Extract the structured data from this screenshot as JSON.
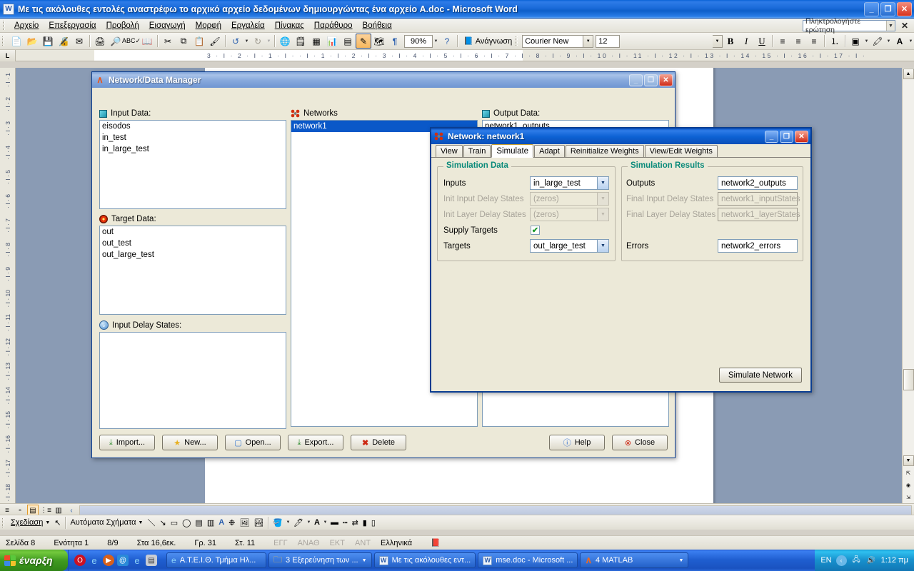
{
  "word": {
    "title": "Με τις ακόλουθες εντολές αναστρέφω το αρχικό αρχείο δεδομένων  δημιουργώντας ένα αρχείο A.doc - Microsoft Word",
    "title_icon": "word-document-icon",
    "minimize": "_",
    "restore": "❐",
    "close": "✕",
    "menus": [
      {
        "label": "Αρχείο"
      },
      {
        "label": "Επεξεργασία"
      },
      {
        "label": "Προβολή"
      },
      {
        "label": "Εισαγωγή"
      },
      {
        "label": "Μορφή"
      },
      {
        "label": "Εργαλεία"
      },
      {
        "label": "Πίνακας"
      },
      {
        "label": "Παράθυρο"
      },
      {
        "label": "Βοήθεια"
      }
    ],
    "ask_a_question": {
      "value": "Πληκτρολογήστε ερώτηση",
      "close": "✕"
    },
    "toolbar": {
      "zoom": "90%",
      "reading_label": "Ανάγνωση",
      "font_name": "Courier New",
      "font_size": "12",
      "bold": "B",
      "italic": "I",
      "underline": "U",
      "icons": [
        "new-document-icon",
        "open-folder-icon",
        "save-icon",
        "permission-icon",
        "email-icon",
        "print-icon",
        "print-preview-icon",
        "spelling-check-icon",
        "research-icon",
        "cut-icon",
        "copy-icon",
        "paste-icon",
        "format-painter-icon",
        "undo-icon",
        "redo-icon",
        "insert-hyperlink-icon",
        "tables-borders-icon",
        "insert-table-icon",
        "insert-excel-icon",
        "columns-icon",
        "drawing-icon",
        "document-map-icon",
        "show-formatting-icon",
        "help-icon"
      ]
    },
    "ruler": {
      "horizontal": "3 · I · 2 · I · 1 · I ·  · I · 1 · I · 2 · I · 3 · I · 4 · I · 5 · I · 6 · I · 7 · I · 8 · I · 9 · I · 10 · I · 11 · I · 12 · I · 13 · I · 14 ·  15 · I · 16 · I · 17 · I ·",
      "vertical": [
        "1",
        "2",
        "3",
        "4",
        "5",
        "6",
        "7",
        "8",
        "9",
        "10",
        "11",
        "12",
        "13",
        "14",
        "15",
        "16",
        "17",
        "18"
      ]
    },
    "viewbar_icons": [
      "normal-view-icon",
      "web-layout-view-icon",
      "print-layout-view-icon",
      "outline-view-icon",
      "reading-layout-view-icon",
      "previous-pane-icon"
    ],
    "drawbar": {
      "draw_label": "Σχεδίαση",
      "autoshapes_label": "Αυτόματα Σχήματα",
      "icons": [
        "select-objects-icon",
        "line-icon",
        "arrow-icon",
        "rectangle-icon",
        "oval-icon",
        "text-box-icon",
        "vertical-text-box-icon",
        "wordart-icon",
        "diagram-icon",
        "clip-art-icon",
        "picture-icon",
        "fill-color-icon",
        "line-color-icon",
        "font-color-icon",
        "line-style-icon",
        "dash-style-icon",
        "arrow-style-icon",
        "shadow-style-icon",
        "3d-style-icon"
      ]
    },
    "status": {
      "page": "Σελίδα 8",
      "section": "Ενότητα 1",
      "pages": "8/9",
      "at": "Στα 16,6εκ.",
      "line": "Γρ. 31",
      "col": "Στ. 11",
      "rec": "ΕΓΓ",
      "trk": "ΑΝΑΘ",
      "ext": "ΕΚΤ",
      "ovr": "ΑΝΤ",
      "language": "Ελληνικά",
      "spell_icon": "spell-check-status-icon"
    }
  },
  "ndm": {
    "title": "Network/Data Manager",
    "title_icon": "matlab-icon",
    "minimize": "_",
    "maximize": "❐",
    "close": "✕",
    "input_data": {
      "label": "Input Data:",
      "icon": "input-data-icon",
      "items": [
        "eisodos",
        "in_test",
        "in_large_test"
      ]
    },
    "target_data": {
      "label": "Target Data:",
      "icon": "target-data-icon",
      "items": [
        "out",
        "out_test",
        "out_large_test"
      ]
    },
    "input_delay_states": {
      "label": "Input Delay States:",
      "icon": "delay-states-icon",
      "items": []
    },
    "networks": {
      "label": "Networks",
      "icon": "network-icon",
      "items": [
        "network1"
      ],
      "selected": "network1"
    },
    "output_data": {
      "label": "Output Data:",
      "icon": "output-data-icon",
      "items": [
        "network1_outputs"
      ]
    },
    "buttons": [
      {
        "label": "Import...",
        "icon": "import-icon"
      },
      {
        "label": "New...",
        "icon": "new-star-icon"
      },
      {
        "label": "Open...",
        "icon": "open-window-icon"
      },
      {
        "label": "Export...",
        "icon": "export-icon"
      },
      {
        "label": "Delete",
        "icon": "delete-x-icon"
      }
    ],
    "right_buttons": [
      {
        "label": "Help",
        "icon": "help-info-icon"
      },
      {
        "label": "Close",
        "icon": "close-circle-icon"
      }
    ]
  },
  "network_dialog": {
    "title": "Network: network1",
    "title_icon": "network-icon",
    "minimize": "_",
    "maximize": "❐",
    "close": "✕",
    "tabs": [
      {
        "label": "View",
        "active": false
      },
      {
        "label": "Train",
        "active": false
      },
      {
        "label": "Simulate",
        "active": true
      },
      {
        "label": "Adapt",
        "active": false
      },
      {
        "label": "Reinitialize Weights",
        "active": false
      },
      {
        "label": "View/Edit Weights",
        "active": false
      }
    ],
    "simulation_data": {
      "title": "Simulation Data",
      "rows": [
        {
          "label": "Inputs",
          "value": "in_large_test",
          "type": "combo",
          "disabled": false
        },
        {
          "label": "Init Input Delay States",
          "value": "(zeros)",
          "type": "combo",
          "disabled": true
        },
        {
          "label": "Init Layer Delay States",
          "value": "(zeros)",
          "type": "combo",
          "disabled": true
        },
        {
          "label": "Supply Targets",
          "value": "✔",
          "type": "checkbox",
          "disabled": false
        },
        {
          "label": "Targets",
          "value": "out_large_test",
          "type": "combo",
          "disabled": false
        }
      ]
    },
    "simulation_results": {
      "title": "Simulation Results",
      "rows": [
        {
          "label": "Outputs",
          "value": "network2_outputs",
          "type": "text",
          "disabled": false
        },
        {
          "label": "Final Input Delay States",
          "value": "network1_inputStates",
          "type": "text",
          "disabled": true
        },
        {
          "label": "Final Layer Delay States",
          "value": "network1_layerStates",
          "type": "text",
          "disabled": true
        },
        {
          "label": "Errors",
          "value": "network2_errors",
          "type": "text",
          "disabled": false
        }
      ]
    },
    "simulate_button": "Simulate Network"
  },
  "taskbar": {
    "start_label": "έναρξη",
    "quick_launch": [
      {
        "icon": "opera-icon"
      },
      {
        "icon": "internet-explorer-icon"
      },
      {
        "icon": "media-player-icon"
      },
      {
        "icon": "browser-icon"
      },
      {
        "icon": "internet-explorer-2-icon"
      },
      {
        "icon": "show-desktop-icon"
      }
    ],
    "tasks": [
      {
        "label": "Α.Τ.Ε.Ι.Θ. Τμήμα Ηλ...",
        "icon": "internet-explorer-icon",
        "grouped": false
      },
      {
        "label": "3 Εξερεύνηση των ...",
        "icon": "folder-icon",
        "grouped": true
      },
      {
        "label": "Με τις ακόλουθες εντ...",
        "icon": "word-document-icon",
        "grouped": false
      },
      {
        "label": "mse.doc - Microsoft ...",
        "icon": "word-document-icon",
        "grouped": false
      },
      {
        "label": "4 MATLAB",
        "icon": "matlab-icon",
        "grouped": true
      }
    ],
    "tray": {
      "language": "EN",
      "icons": [
        "show-hidden-icons-icon",
        "network-icon",
        "volume-icon"
      ],
      "clock": "1:12 πμ"
    }
  },
  "colors": {
    "word_title": "#1a6ad9",
    "active_title": "#0a55c8",
    "inactive_title": "#86a8dc",
    "panel_title": "#0a8a7a",
    "dialog_bg": "#ece9d8",
    "selection": "#0a58c8",
    "desktop": "#8a9bb4"
  }
}
